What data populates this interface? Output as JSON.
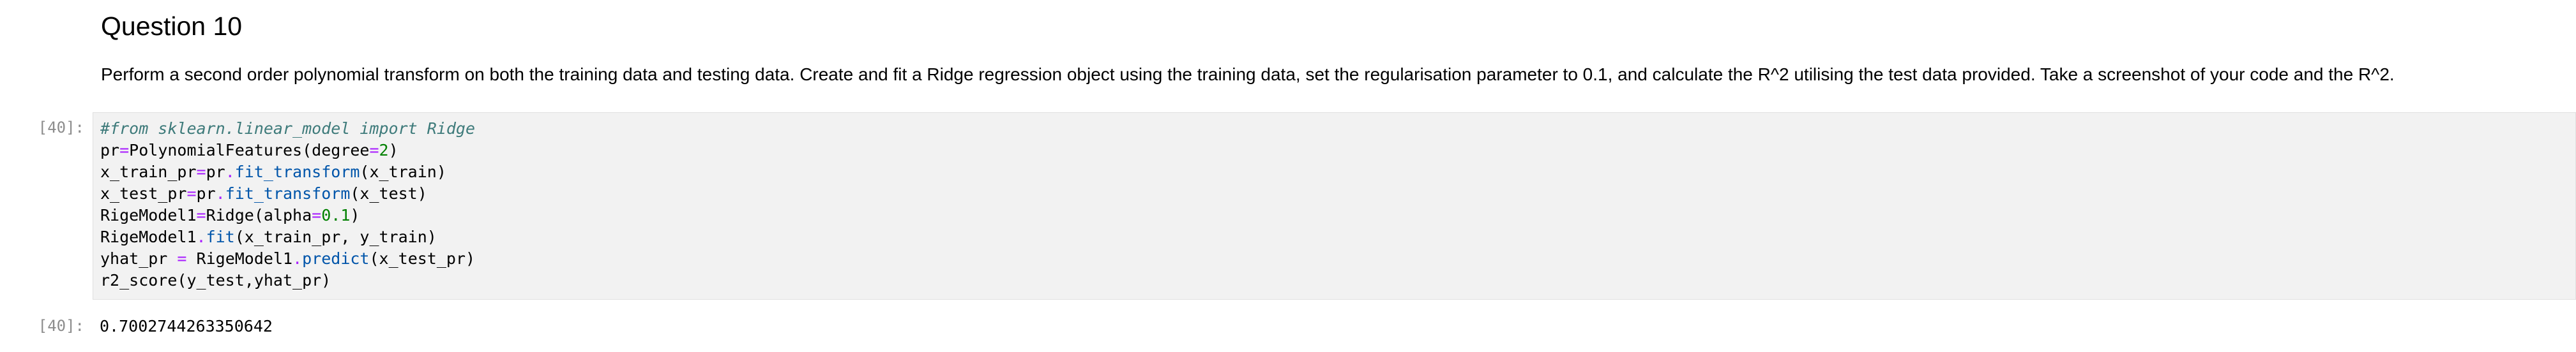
{
  "markdown": {
    "heading": "Question 10",
    "paragraph": "Perform a second order polynomial transform on both the training data and testing data. Create and fit a Ridge regression object using the training data, set the regularisation parameter to 0.1, and calculate the R^2 utilising the test data provided. Take a screenshot of your code and the R^2."
  },
  "input_cell": {
    "prompt": "[40]:",
    "lines": [
      [
        {
          "t": "#from sklearn.linear_model import Ridge",
          "c": "cm"
        }
      ],
      [
        {
          "t": "pr"
        },
        {
          "t": "=",
          "c": "op"
        },
        {
          "t": "PolynomialFeatures(degree"
        },
        {
          "t": "=",
          "c": "op"
        },
        {
          "t": "2",
          "c": "num"
        },
        {
          "t": ")"
        }
      ],
      [
        {
          "t": "x_train_pr"
        },
        {
          "t": "=",
          "c": "op"
        },
        {
          "t": "pr"
        },
        {
          "t": ".",
          "c": "op"
        },
        {
          "t": "fit_transform",
          "c": "fn"
        },
        {
          "t": "(x_train)"
        }
      ],
      [
        {
          "t": "x_test_pr"
        },
        {
          "t": "=",
          "c": "op"
        },
        {
          "t": "pr"
        },
        {
          "t": ".",
          "c": "op"
        },
        {
          "t": "fit_transform",
          "c": "fn"
        },
        {
          "t": "(x_test)"
        }
      ],
      [
        {
          "t": "RigeModel1"
        },
        {
          "t": "=",
          "c": "op"
        },
        {
          "t": "Ridge(alpha"
        },
        {
          "t": "=",
          "c": "op"
        },
        {
          "t": "0.1",
          "c": "num"
        },
        {
          "t": ")"
        }
      ],
      [
        {
          "t": "RigeModel1"
        },
        {
          "t": ".",
          "c": "op"
        },
        {
          "t": "fit",
          "c": "fn"
        },
        {
          "t": "(x_train_pr, y_train)"
        }
      ],
      [
        {
          "t": "yhat_pr "
        },
        {
          "t": "=",
          "c": "op"
        },
        {
          "t": " RigeModel1"
        },
        {
          "t": ".",
          "c": "op"
        },
        {
          "t": "predict",
          "c": "fn"
        },
        {
          "t": "(x_test_pr)"
        }
      ],
      [
        {
          "t": "r2_score(y_test,yhat_pr)"
        }
      ]
    ]
  },
  "output_cell": {
    "prompt": "[40]:",
    "value": "0.7002744263350642"
  }
}
